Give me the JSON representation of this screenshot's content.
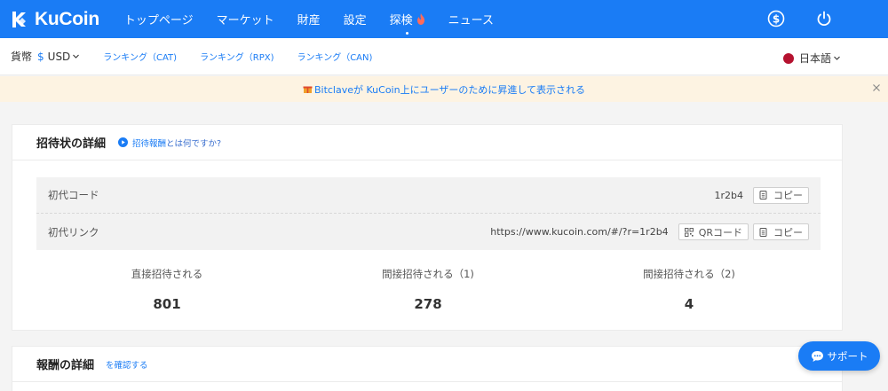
{
  "topnav": {
    "logo_text": "KuCoin",
    "items": [
      {
        "label": "トップページ"
      },
      {
        "label": "マーケット"
      },
      {
        "label": "財産"
      },
      {
        "label": "設定"
      },
      {
        "label": "探検"
      },
      {
        "label": "ニュース"
      }
    ],
    "icons": [
      "dollar-circle-icon",
      "power-icon"
    ]
  },
  "subnav": {
    "currency_label": "貨幣",
    "currency_symbol": "$",
    "currency_value": "USD",
    "rank_links": [
      {
        "label": "ランキング（CAT)"
      },
      {
        "label": "ランキング（RPX)"
      },
      {
        "label": "ランキング（CAN)"
      }
    ],
    "language": "日本語"
  },
  "notice": {
    "text": "Bitclaveが KuCoin上にユーザーのために昇進して表示される"
  },
  "invite_card": {
    "title": "招待状の詳細",
    "help_prefix": "招待報酬",
    "help_suffix": "とは何ですか?",
    "rows": [
      {
        "label": "初代コード",
        "value": "1r2b4"
      },
      {
        "label": "初代リンク",
        "value": "https://www.kucoin.com/#/?r=1r2b4"
      }
    ],
    "copy_label": "コピー",
    "qr_label": "QRコード",
    "stats": [
      {
        "label": "直接招待される",
        "value": "801"
      },
      {
        "label": "間接招待される（1)",
        "value": "278"
      },
      {
        "label": "間接招待される（2)",
        "value": "4"
      }
    ]
  },
  "reward_card": {
    "title": "報酬の詳細",
    "confirm_link": "を確認する"
  },
  "support": {
    "label": "サポート"
  },
  "colors": {
    "brand": "#1a7cf5",
    "notice_bg": "#fdf3e2",
    "flag": "#b5122f"
  }
}
